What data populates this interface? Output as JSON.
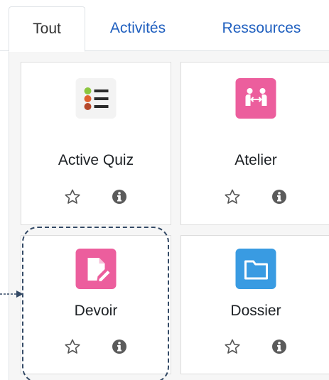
{
  "tabs": [
    {
      "label": "Tout",
      "active": true
    },
    {
      "label": "Activités",
      "active": false
    },
    {
      "label": "Ressources",
      "active": false
    }
  ],
  "cards": [
    {
      "name": "Active Quiz",
      "icon": "list-bullets-icon",
      "icon_bg": "#f3f3f3"
    },
    {
      "name": "Atelier",
      "icon": "workshop-people-icon",
      "icon_bg": "#ec5e9d"
    },
    {
      "name": "Devoir",
      "icon": "assignment-pencil-icon",
      "icon_bg": "#ec5e9d"
    },
    {
      "name": "Dossier",
      "icon": "folder-icon",
      "icon_bg": "#399be2"
    }
  ],
  "colors": {
    "link": "#1f5fbf",
    "pink": "#ec5e9d",
    "blue": "#399be2",
    "highlight": "#344a66"
  }
}
